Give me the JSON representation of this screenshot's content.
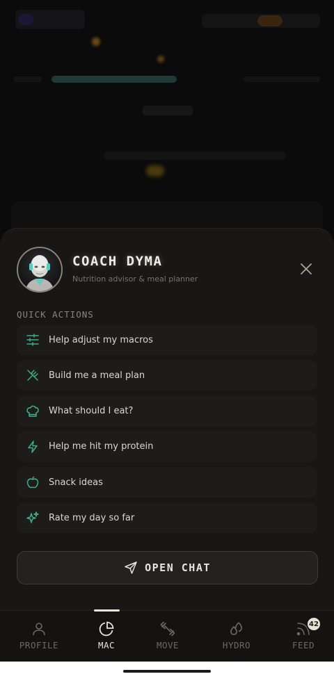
{
  "coach": {
    "name": "COACH DYMA",
    "subtitle": "Nutrition advisor & meal planner"
  },
  "quick_actions": {
    "title": "QUICK ACTIONS",
    "items": [
      {
        "label": "Help adjust my macros",
        "icon": "sliders-icon"
      },
      {
        "label": "Build me a meal plan",
        "icon": "utensils-crossed-icon"
      },
      {
        "label": "What should I eat?",
        "icon": "chef-hat-icon"
      },
      {
        "label": "Help me hit my protein",
        "icon": "lightning-icon"
      },
      {
        "label": "Snack ideas",
        "icon": "apple-icon"
      },
      {
        "label": "Rate my day so far",
        "icon": "sparkles-icon"
      }
    ]
  },
  "open_chat": {
    "label": "OPEN CHAT",
    "icon": "send-icon"
  },
  "nav": {
    "items": [
      {
        "label": "PROFILE",
        "icon": "user-icon",
        "active": false
      },
      {
        "label": "MAC",
        "icon": "pie-chart-icon",
        "active": true
      },
      {
        "label": "MOVE",
        "icon": "dumbbell-icon",
        "active": false
      },
      {
        "label": "HYDRO",
        "icon": "droplets-icon",
        "active": false
      },
      {
        "label": "FEED",
        "icon": "rss-icon",
        "active": false
      }
    ],
    "feed_badge": "42"
  },
  "colors": {
    "accent_teal": "#3fae8e",
    "sheet_bg": "#181716",
    "text_primary": "#e8e4dc",
    "text_muted": "#77736b"
  }
}
